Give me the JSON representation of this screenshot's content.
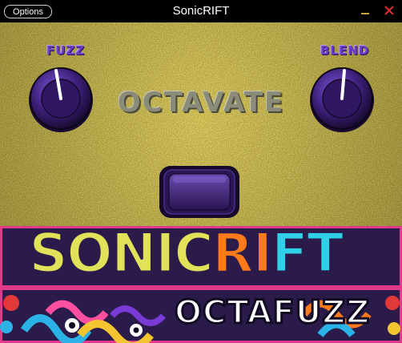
{
  "window": {
    "title": "SonicRIFT",
    "options_label": "Options",
    "minimize_icon": "minimize-icon",
    "close_icon": "close-icon",
    "close_color": "#d9302f",
    "minimize_color": "#c8a23a"
  },
  "pedal": {
    "body_color": "#c9b63d",
    "effect_name": "OCTAVATE",
    "knobs": [
      {
        "label": "FUZZ",
        "icon": "knob-icon"
      },
      {
        "label": "BLEND",
        "icon": "knob-icon"
      }
    ],
    "footswitch_icon": "footswitch-icon",
    "knob_color": "#3d1f7a"
  },
  "branding": {
    "brand_part1": "SONIC",
    "brand_part2": "RI",
    "brand_part3": "FT",
    "product_name": "OCTAFUZZ"
  }
}
